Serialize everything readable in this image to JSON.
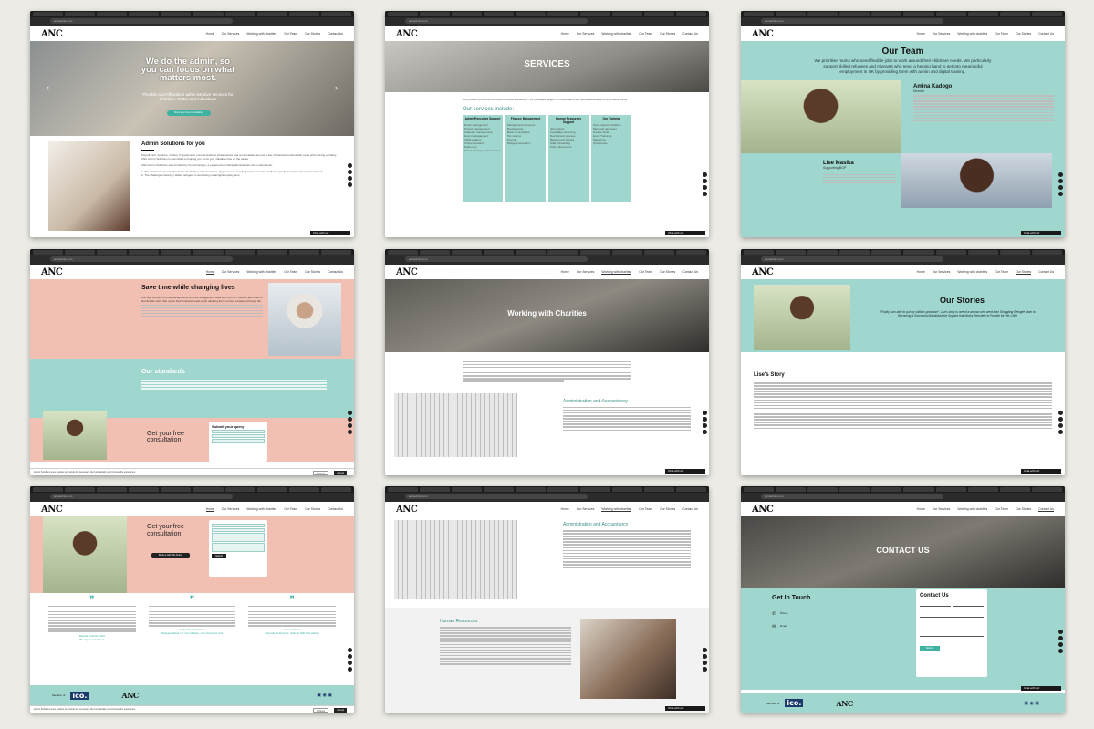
{
  "browser": {
    "url": "amcadmin.com"
  },
  "nav": {
    "logo": "ANC",
    "logo_sub": "ADMIN SOLUTIONS",
    "items": [
      "Home",
      "Our Services",
      "Working with charities",
      "Our Team",
      "Our Stories",
      "Contact Us"
    ]
  },
  "chat_label": "Chat with us!",
  "panel1": {
    "hero_title": "We do the admin, so you can focus on what matters most.",
    "hero_sub": "Flexible and Affordable administrative services for charities, SMEs and individuals",
    "hero_button": "Book your free consultation",
    "section_title": "Admin Solutions for you",
    "body": "Payroll, rent, furniture, utilities, IT equipment, communications infrastructure and consumables are just a few of financial burdens that come with running a charity. ANC Admin Solutions is committed to helping you focus your valuable time on the cause.",
    "body2": "ANC Admin Solutions was founded by Amina Kadogo, a experienced charity administrator who understands:",
    "list": [
      "1. The limitations of empathic but multi charities who don't have bigger teams, resulting in the executive staff doing both strategic and operational work",
      "2. The challenges faced by skilled refugees in accessing meaningful employment"
    ]
  },
  "panel2": {
    "hero_title": "SERVICES",
    "intro": "We provide a proactive and expert remote assistance. Our packages range from individual smart remote assistants to Multi-Skills teams.",
    "section_title": "Our services include:",
    "columns": [
      {
        "title": "Admin/Executive Support",
        "items": [
          "Email management",
          "Project management",
          "Calendar management",
          "Event Management",
          "CRM updates",
          "Online Research",
          "Data entry",
          "Travel booking and itineraries"
        ]
      },
      {
        "title": "Finance Management",
        "items": [
          "Management accounts",
          "Bookkeeping",
          "Bank reconciliation",
          "Tax returns",
          "Payroll",
          "Budget preparation"
        ]
      },
      {
        "title": "Human Resources Support",
        "items": [
          "Job posting",
          "Candidate screening",
          "Recruitment process",
          "Background checks",
          "Staff onboarding",
          "Policy documents"
        ]
      },
      {
        "title": "Our Training",
        "items": [
          "Team capacity building",
          "Microsoft packages",
          "Google Suite",
          "Excel Trainings",
          "Salesforce",
          "Quickbooks"
        ]
      }
    ]
  },
  "panel3": {
    "title": "Our Team",
    "intro": "We prioritise mums who need flexible jobs to work around their childcare needs. We particularly support skilled refugees and migrants who need a helping hand to get into meaningful employment in UK by providing them with admin and digital training.",
    "member1_name": "Amina Kadogo",
    "member1_role": "Director",
    "member2_name": "Lise Masika",
    "member2_role": "Supporting BGP"
  },
  "panel4": {
    "title": "Save time while changing lives",
    "body": "We help mothers from all backgrounds who are struggling to cope with the U.K. careers and need to find flexible work that meets their financial needs while allowing them to have a balanced family life.",
    "standards_title": "Our standards",
    "consult_title": "Get your free consultation",
    "form_title": "Submit your query",
    "cookie": "Admin Solutions uses cookies to provide the necessary site functionality and improve the experience.",
    "cookie_settings": "Settings",
    "cookie_accept": "Accept"
  },
  "panel5": {
    "hero_title": "Working with Charities",
    "section_title": "Administration and Accountancy"
  },
  "panel6": {
    "title": "Our Stories",
    "quote": "\"Finally I am able to put my skills to good use\". Lise's story is one of a woman who went from Struggling Refugee Mum to Becoming a Successful Administrative Support that Works Remotely to Provide for Her Child",
    "story_title": "Lise's Story"
  },
  "panel7": {
    "consult_title": "Get your free consultation",
    "consult_button": "Book a call with Amina",
    "submit": "Submit",
    "testimonials": [
      {
        "name": "Rachel Driscoll, CEO",
        "org": "Bloody Good Period"
      },
      {
        "name": "Emily Churchill Zaraa",
        "org": "Refugee Week UK Coordinator, Counterpoints Arts"
      },
      {
        "name": "Kumar Shanti",
        "org": "Operations Director, Hailmet NRI Foundation"
      }
    ],
    "member_of": "Member of",
    "ico": "ico.",
    "cookie_settings": "Settings",
    "cookie_accept": "Accept"
  },
  "panel8": {
    "section_title": "Administration and Accountancy",
    "hr_title": "Human Resources"
  },
  "panel9": {
    "hero_title": "CONTACT US",
    "get_in_touch": "Get In Touch",
    "phone_label": "Phone",
    "email_label": "Email",
    "form_title": "Contact Us",
    "submit": "Submit",
    "member_of": "Member of",
    "ico": "ico."
  }
}
